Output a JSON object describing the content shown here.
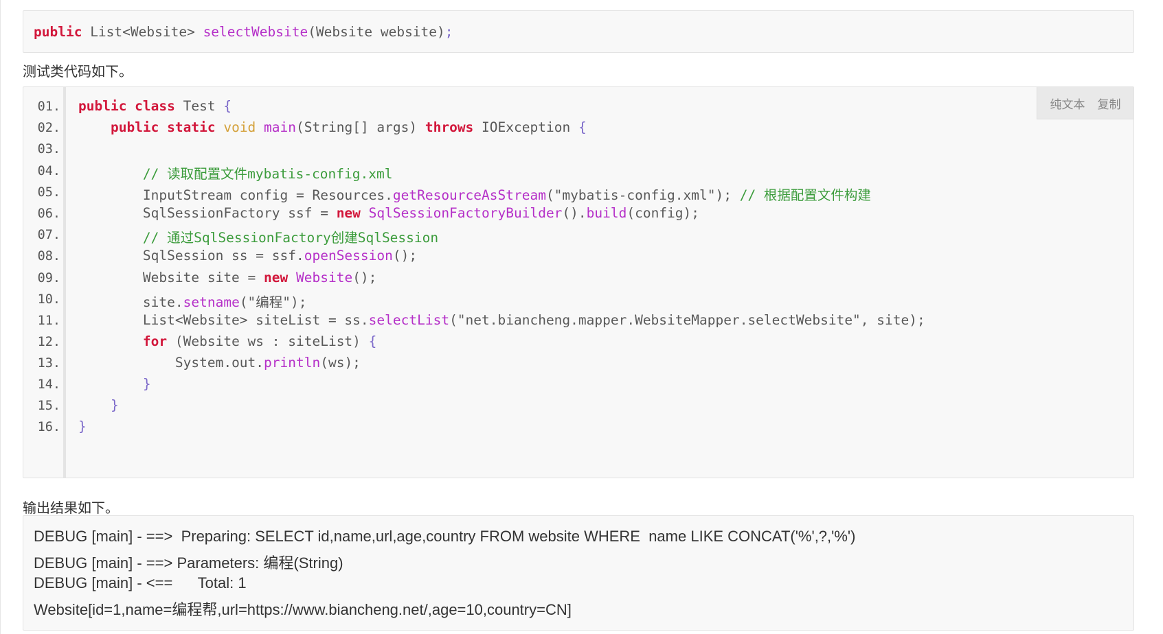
{
  "signature": {
    "kw": "public",
    "rest1": " List<Website> ",
    "fn": "selectWebsite",
    "rest2": "(Website website)",
    "semi": ";"
  },
  "paragraphs": {
    "test_intro": "测试类代码如下。",
    "output_intro": "输出结果如下。"
  },
  "toolbar": {
    "plain_text": "纯文本",
    "copy": "复制"
  },
  "line_numbers": [
    "01.",
    "02.",
    "03.",
    "04.",
    "05.",
    "06.",
    "07.",
    "08.",
    "09.",
    "10.",
    "11.",
    "12.",
    "13.",
    "14.",
    "15.",
    "16."
  ],
  "code": {
    "l1": {
      "k1": "public class",
      "t": " Test ",
      "b": "{"
    },
    "l2": {
      "k1": "public static",
      "v": " void ",
      "f": "main",
      "t1": "(String[] args) ",
      "k2": "throws",
      "t2": " IOException ",
      "b": "{"
    },
    "l4": {
      "c": "// 读取配置文件mybatis-config.xml"
    },
    "l5": {
      "t1": "InputStream config = Resources.",
      "f": "getResourceAsStream",
      "t2": "(\"mybatis-config.xml\"); ",
      "c": "// 根据配置文件构建"
    },
    "l6": {
      "t1": "SqlSessionFactory ssf = ",
      "k": "new",
      "f1": " SqlSessionFactoryBuilder",
      "t2": "().",
      "f2": "build",
      "t3": "(config);"
    },
    "l7": {
      "c": "// 通过SqlSessionFactory创建SqlSession"
    },
    "l8": {
      "t1": "SqlSession ss = ssf.",
      "f": "openSession",
      "t2": "();"
    },
    "l9": {
      "t1": "Website site = ",
      "k": "new",
      "f": " Website",
      "t2": "();"
    },
    "l10": {
      "t1": "site.",
      "f": "setname",
      "t2": "(\"编程\");"
    },
    "l11": {
      "t1": "List<Website> siteList = ss.",
      "f": "selectList",
      "t2": "(\"net.biancheng.mapper.WebsiteMapper.selectWebsite\", site);"
    },
    "l12": {
      "k": "for",
      "t": " (Website ws : siteList) ",
      "b": "{"
    },
    "l13": {
      "t1": "System.out.",
      "f": "println",
      "t2": "(ws);"
    },
    "l14": {
      "b": "}"
    },
    "l15": {
      "b": "}"
    },
    "l16": {
      "b": "}"
    }
  },
  "output": [
    "DEBUG [main] - ==>  Preparing: SELECT id,name,url,age,country FROM website WHERE  name LIKE CONCAT('%',?,'%')",
    "DEBUG [main] - ==> Parameters: 编程(String)",
    "DEBUG [main] - <==      Total: 1",
    "Website[id=1,name=编程帮,url=https://www.biancheng.net/,age=10,country=CN]"
  ]
}
